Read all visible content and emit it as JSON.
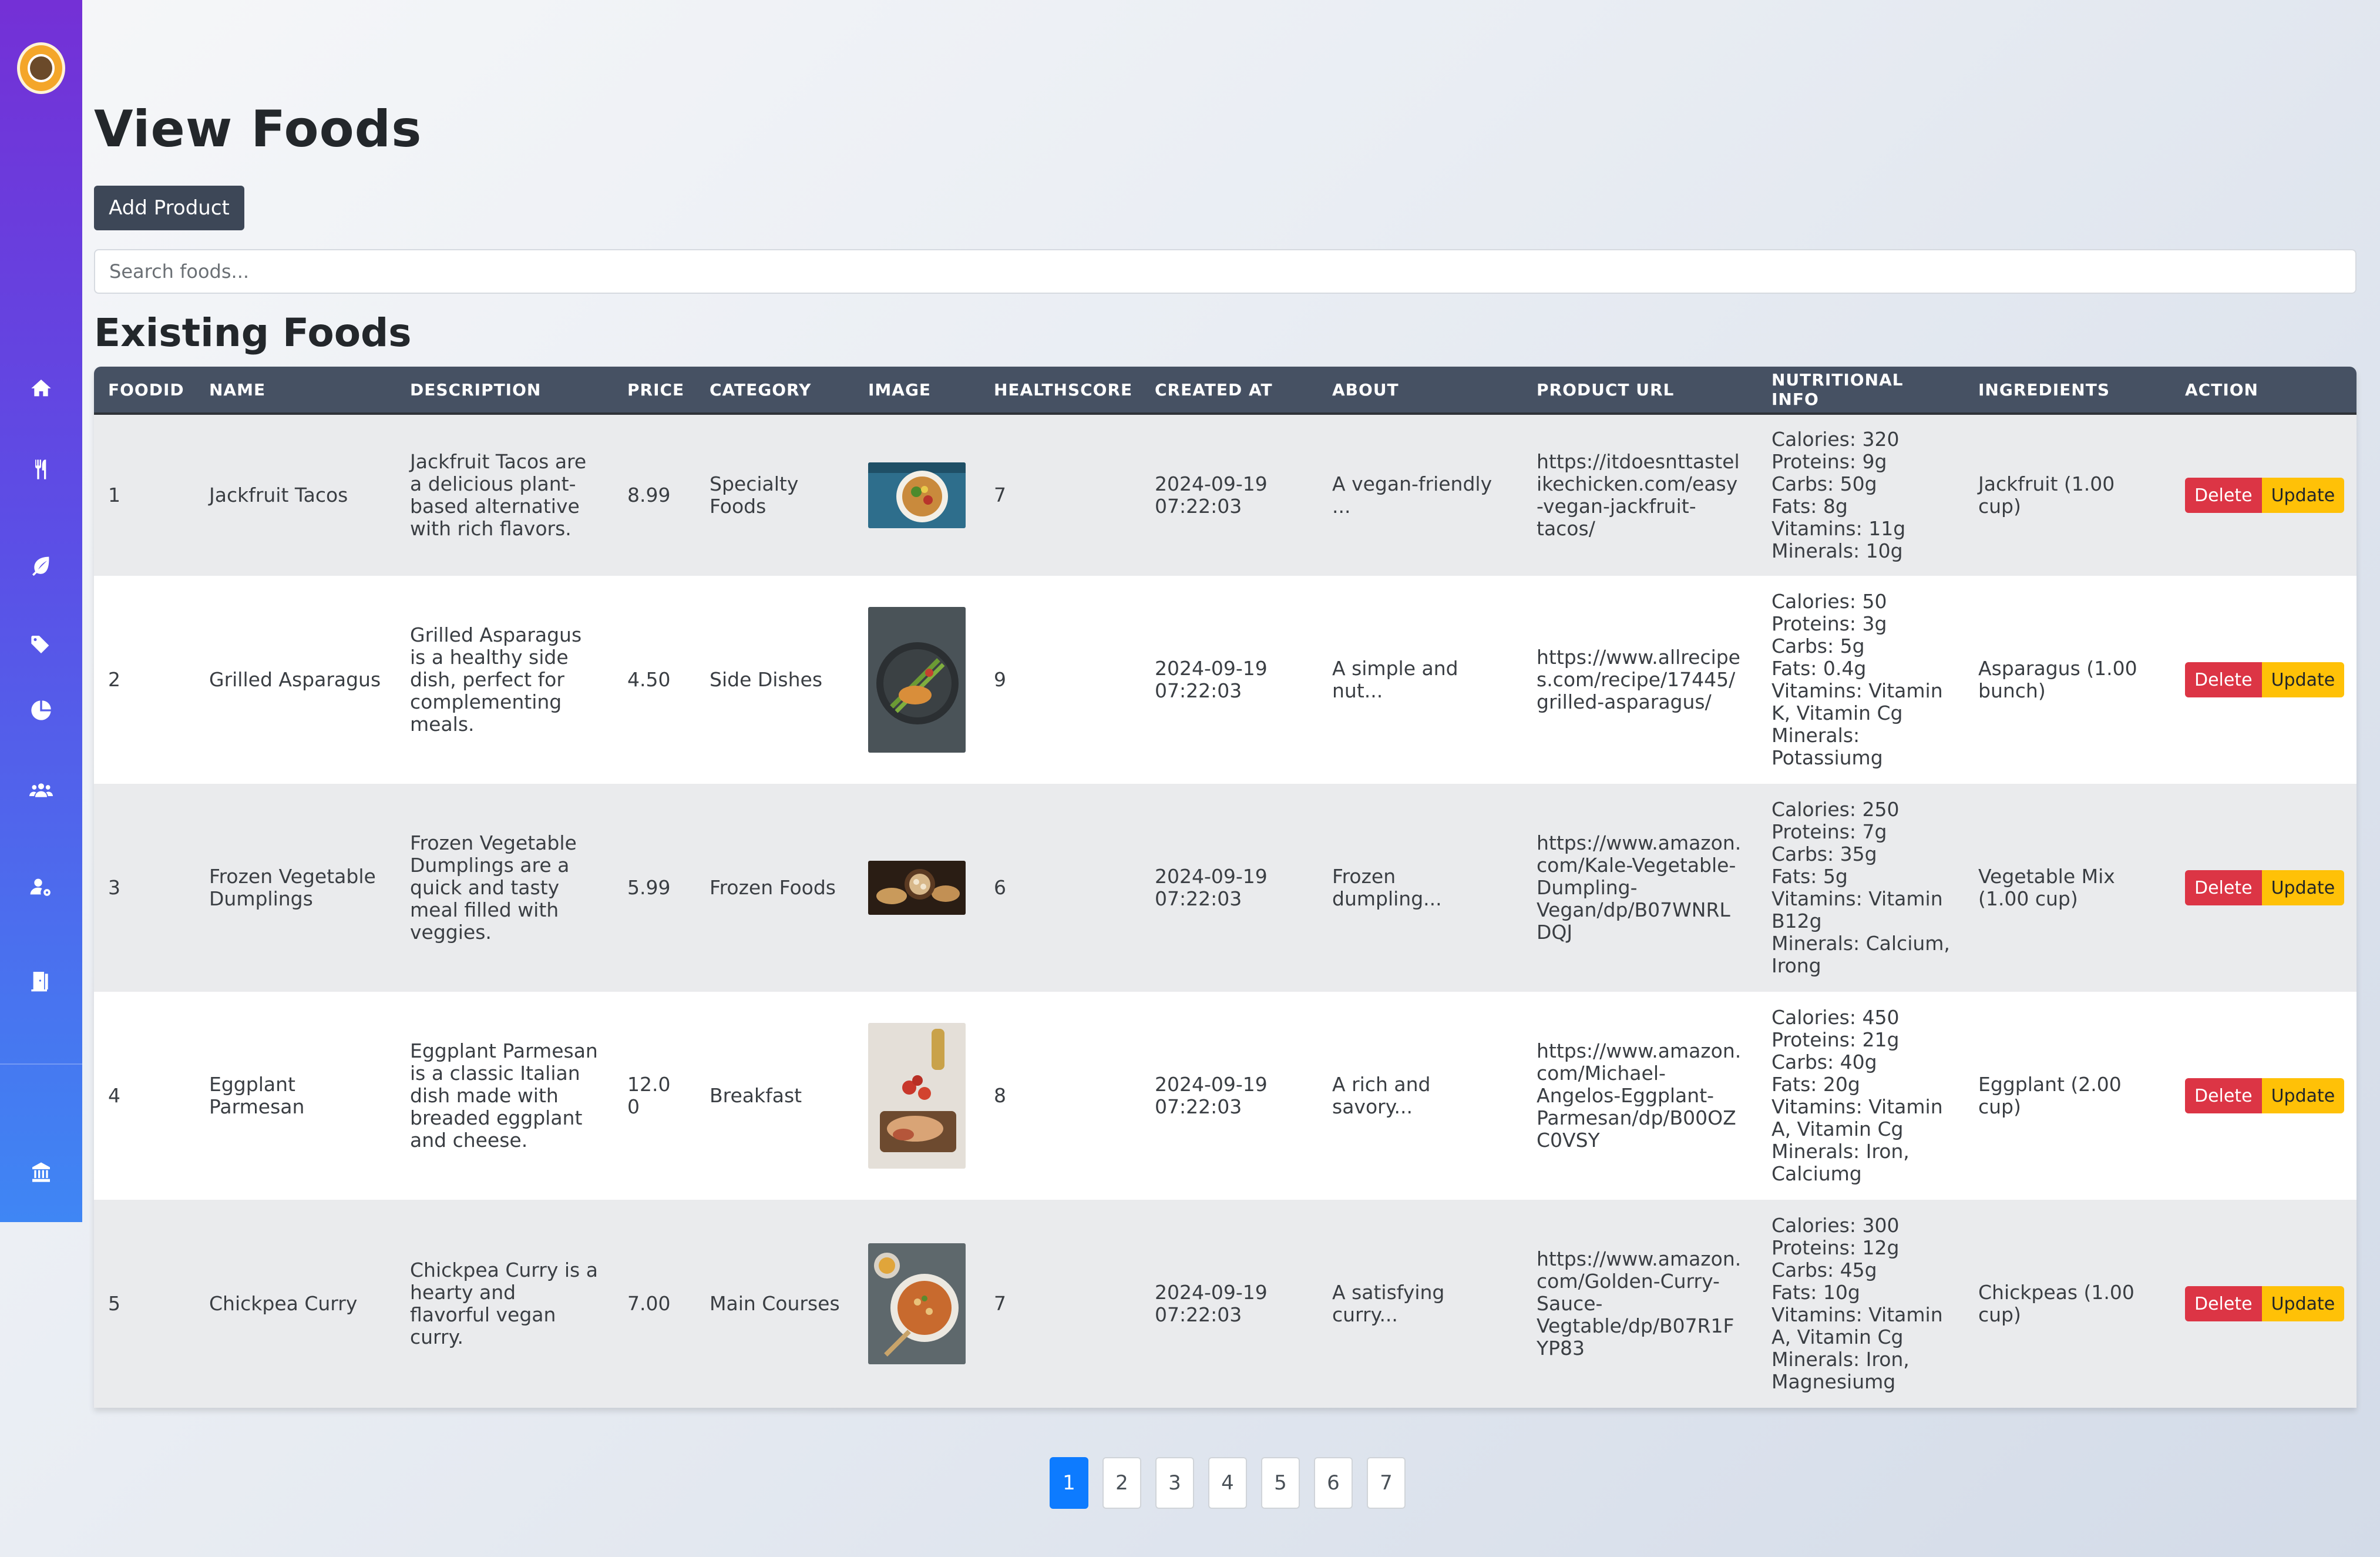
{
  "page": {
    "title": "View Foods"
  },
  "toolbar": {
    "add_label": "Add Product"
  },
  "search": {
    "placeholder": "Search foods..."
  },
  "section": {
    "title": "Existing Foods"
  },
  "sidebar": {
    "icons": [
      "home-icon",
      "utensils-icon",
      "leaf-icon",
      "tags-icon",
      "pie-chart-icon",
      "users-icon",
      "user-cog-icon",
      "door-exit-icon",
      "building-icon"
    ]
  },
  "table": {
    "headers": [
      "FOODID",
      "NAME",
      "DESCRIPTION",
      "PRICE",
      "CATEGORY",
      "IMAGE",
      "HEALTHSCORE",
      "CREATED AT",
      "ABOUT",
      "PRODUCT URL",
      "NUTRITIONAL INFO",
      "INGREDIENTS",
      "ACTION"
    ],
    "delete_label": "Delete",
    "update_label": "Update",
    "rows": [
      {
        "id": "1",
        "name": "Jackfruit Tacos",
        "description": "Jackfruit Tacos are a delicious plant-based alternative with rich flavors.",
        "price": "8.99",
        "category": "Specialty Foods",
        "healthscore": "7",
        "created_at": "2024-09-19 07:22:03",
        "about": "A vegan-friendly ...",
        "url": "https://itdoesnttastelikechicken.com/easy-vegan-jackfruit-tacos/",
        "nutrition": [
          "Calories: 320",
          "Proteins: 9g",
          "Carbs: 50g",
          "Fats: 8g",
          "Vitamins: 11g",
          "Minerals: 10g"
        ],
        "ingredients": "Jackfruit (1.00 cup)"
      },
      {
        "id": "2",
        "name": "Grilled Asparagus",
        "description": "Grilled Asparagus is a healthy side dish, perfect for complementing meals.",
        "price": "4.50",
        "category": "Side Dishes",
        "healthscore": "9",
        "created_at": "2024-09-19 07:22:03",
        "about": "A simple and nut...",
        "url": "https://www.allrecipes.com/recipe/17445/grilled-asparagus/",
        "nutrition": [
          "Calories: 50",
          "Proteins: 3g",
          "Carbs: 5g",
          "Fats: 0.4g",
          "Vitamins: Vitamin K, Vitamin Cg",
          "Minerals: Potassiumg"
        ],
        "ingredients": "Asparagus (1.00 bunch)"
      },
      {
        "id": "3",
        "name": "Frozen Vegetable Dumplings",
        "description": "Frozen Vegetable Dumplings are a quick and tasty meal filled with veggies.",
        "price": "5.99",
        "category": "Frozen Foods",
        "healthscore": "6",
        "created_at": "2024-09-19 07:22:03",
        "about": "Frozen dumpling...",
        "url": "https://www.amazon.com/Kale-Vegetable-Dumpling-Vegan/dp/B07WNRLDQJ",
        "nutrition": [
          "Calories: 250",
          "Proteins: 7g",
          "Carbs: 35g",
          "Fats: 5g",
          "Vitamins: Vitamin B12g",
          "Minerals: Calcium, Irong"
        ],
        "ingredients": "Vegetable Mix (1.00 cup)"
      },
      {
        "id": "4",
        "name": "Eggplant Parmesan",
        "description": "Eggplant Parmesan is a classic Italian dish made with breaded eggplant and cheese.",
        "price": "12.00",
        "category": "Breakfast",
        "healthscore": "8",
        "created_at": "2024-09-19 07:22:03",
        "about": "A rich and savory...",
        "url": "https://www.amazon.com/Michael-Angelos-Eggplant-Parmesan/dp/B00OZC0VSY",
        "nutrition": [
          "Calories: 450",
          "Proteins: 21g",
          "Carbs: 40g",
          "Fats: 20g",
          "Vitamins: Vitamin A, Vitamin Cg",
          "Minerals: Iron, Calciumg"
        ],
        "ingredients": "Eggplant (2.00 cup)"
      },
      {
        "id": "5",
        "name": "Chickpea Curry",
        "description": "Chickpea Curry is a hearty and flavorful vegan curry.",
        "price": "7.00",
        "category": "Main Courses",
        "healthscore": "7",
        "created_at": "2024-09-19 07:22:03",
        "about": "A satisfying curry...",
        "url": "https://www.amazon.com/Golden-Curry-Sauce-Vegtable/dp/B07R1FYP83",
        "nutrition": [
          "Calories: 300",
          "Proteins: 12g",
          "Carbs: 45g",
          "Fats: 10g",
          "Vitamins: Vitamin A, Vitamin Cg",
          "Minerals: Iron, Magnesiumg"
        ],
        "ingredients": "Chickpeas (1.00 cup)"
      }
    ]
  },
  "pagination": {
    "pages": [
      "1",
      "2",
      "3",
      "4",
      "5",
      "6",
      "7"
    ],
    "current": "1"
  }
}
